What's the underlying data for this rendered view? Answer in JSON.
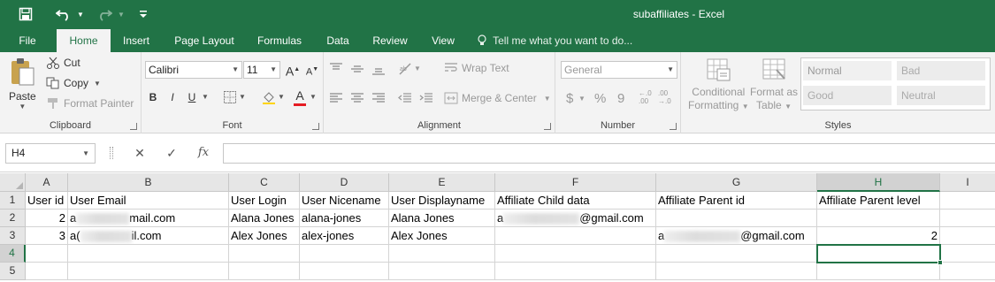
{
  "titlebar": {
    "title": "subaffiliates - Excel",
    "save_icon": "save-icon",
    "undo_icon": "undo-icon",
    "redo_icon": "redo-icon",
    "customize_icon": "customize-quick-access-icon"
  },
  "tabs": [
    "File",
    "Home",
    "Insert",
    "Page Layout",
    "Formulas",
    "Data",
    "Review",
    "View"
  ],
  "active_tab": "Home",
  "tell_me": "Tell me what you want to do...",
  "ribbon": {
    "clipboard": {
      "label": "Clipboard",
      "paste": "Paste",
      "cut": "Cut",
      "copy": "Copy",
      "format_painter": "Format Painter"
    },
    "font": {
      "label": "Font",
      "font_name": "Calibri",
      "font_size": "11",
      "bold": "B",
      "italic": "I",
      "underline": "U",
      "font_color": "A"
    },
    "alignment": {
      "label": "Alignment",
      "wrap_text": "Wrap Text",
      "merge_center": "Merge & Center"
    },
    "number": {
      "label": "Number",
      "format": "General",
      "currency": "$",
      "percent": "%",
      "comma": "9",
      "inc_decimal": "←.0\n.00",
      "dec_decimal": ".00\n→.0"
    },
    "styles": {
      "label": "Styles",
      "conditional_formatting_1": "Conditional",
      "conditional_formatting_2": "Formatting",
      "format_as_table_1": "Format as",
      "format_as_table_2": "Table",
      "normal": "Normal",
      "bad": "Bad",
      "good": "Good",
      "neutral": "Neutral"
    }
  },
  "formula_bar": {
    "name_box": "H4",
    "cancel": "✕",
    "enter": "✓",
    "fx": "fx",
    "value": ""
  },
  "columns": [
    "A",
    "B",
    "C",
    "D",
    "E",
    "F",
    "G",
    "H",
    "I"
  ],
  "selected_column": "H",
  "rows": [
    "1",
    "2",
    "3",
    "4",
    "5"
  ],
  "selected_row": "4",
  "cells": {
    "r1": {
      "A": "User id",
      "B": "User Email",
      "C": "User Login",
      "D": "User Nicename",
      "E": "User Displayname",
      "F": "Affiliate Child data",
      "G": "Affiliate Parent id",
      "H": "Affiliate Parent level"
    },
    "r2": {
      "A": "2",
      "B_prefix": "a",
      "B_suffix": "mail.com",
      "C": "Alana Jones",
      "D": "alana-jones",
      "E": "Alana Jones",
      "F_prefix": "a",
      "F_suffix": "@gmail.com"
    },
    "r3": {
      "A": "3",
      "B_prefix": "a(",
      "B_suffix": "il.com",
      "C": "Alex Jones",
      "D": "alex-jones",
      "E": "Alex Jones",
      "G_prefix": "a",
      "G_suffix": "@gmail.com",
      "H": "2"
    }
  },
  "colors": {
    "excel_green": "#217346",
    "ribbon_bg": "#f3f3f3",
    "header_bg": "#e6e6e6"
  }
}
